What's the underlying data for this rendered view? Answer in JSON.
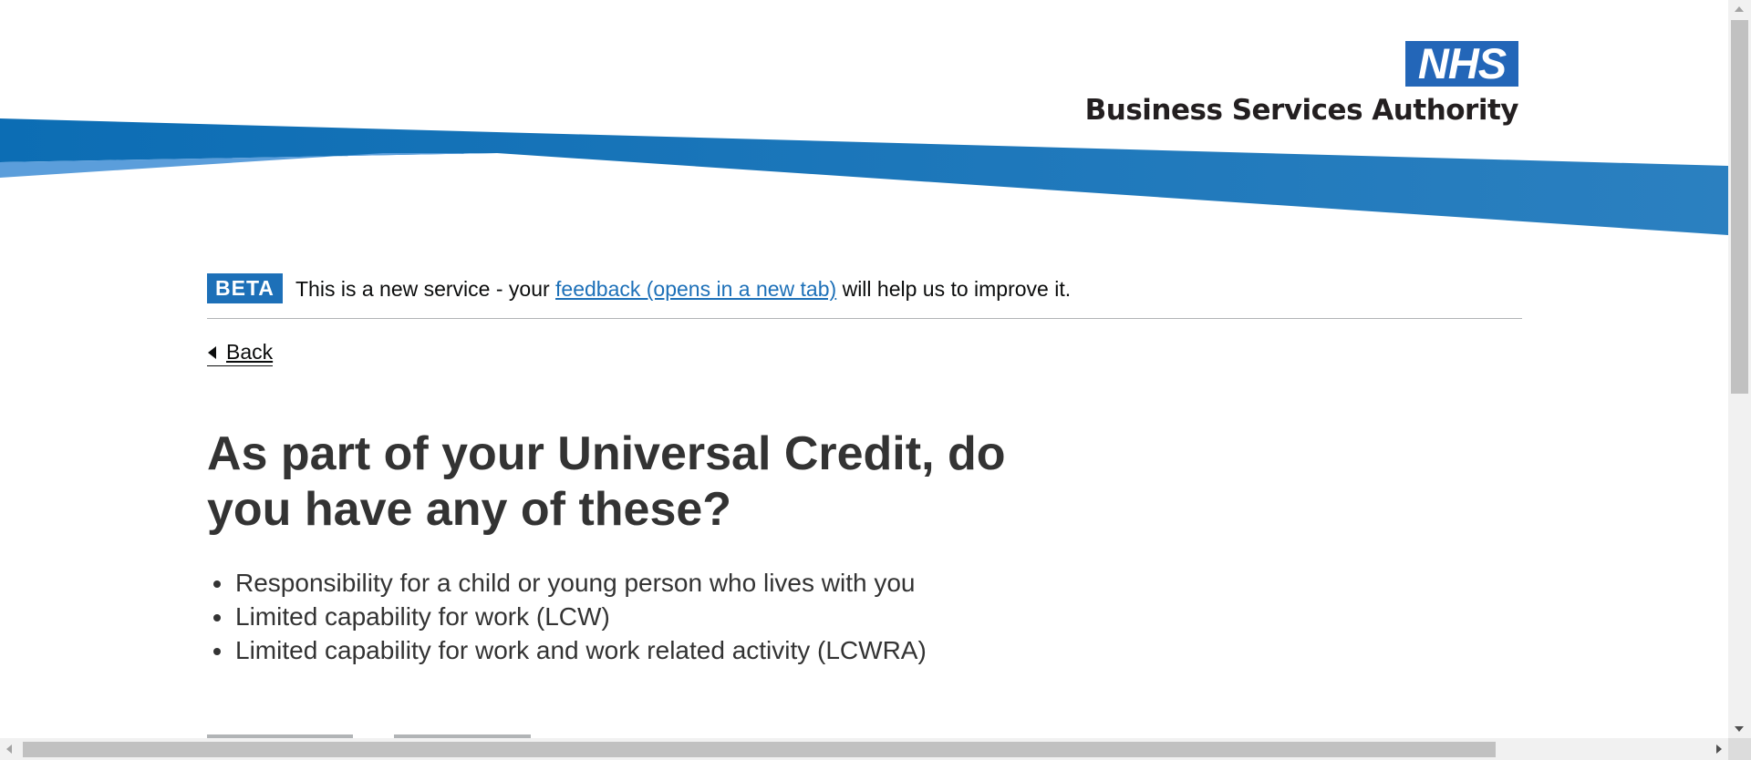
{
  "header": {
    "logo_mark": "NHS",
    "org_name": "Business Services Authority",
    "colors": {
      "banner_dark": "#0f6eb5",
      "banner_light": "#4c96d7",
      "nhs_blue": "#2366b8"
    }
  },
  "phase_banner": {
    "tag": "BETA",
    "text_before": "This is a new service - your ",
    "link_text": "feedback (opens in a new tab)",
    "text_after": " will help us to improve it."
  },
  "back_link": {
    "label": "Back",
    "icon": "chevron-left-icon"
  },
  "main": {
    "question": "As part of your Universal Credit, do you have any of these?",
    "criteria": [
      "Responsibility for a child or young person who lives with you",
      "Limited capability for work (LCW)",
      "Limited capability for work and work related activity (LCWRA)"
    ]
  },
  "scrollbars": {
    "vertical": "visible",
    "horizontal": "visible"
  }
}
